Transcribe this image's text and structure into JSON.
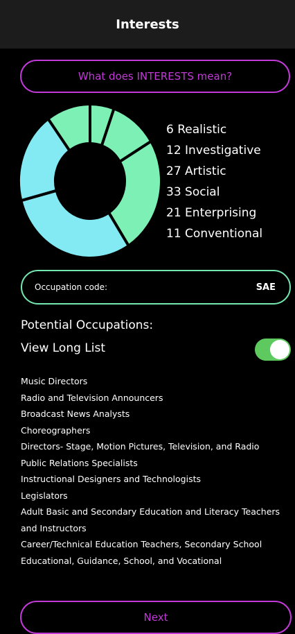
{
  "header": {
    "title": "Interests"
  },
  "meaning_button": {
    "label": "What does INTERESTS mean?"
  },
  "chart_data": {
    "type": "pie",
    "categories": [
      "Realistic",
      "Investigative",
      "Artistic",
      "Social",
      "Enterprising",
      "Conventional"
    ],
    "values": [
      6,
      12,
      27,
      33,
      21,
      11
    ],
    "colors": [
      "#7df0b6",
      "#7df0b6",
      "#7df0b6",
      "#83eaf4",
      "#83eaf4",
      "#7df0b6"
    ]
  },
  "interest_types": [
    {
      "value": "6",
      "name": "Realistic"
    },
    {
      "value": "12",
      "name": "Investigative"
    },
    {
      "value": "27",
      "name": "Artistic"
    },
    {
      "value": "33",
      "name": "Social"
    },
    {
      "value": "21",
      "name": "Enterprising"
    },
    {
      "value": "11",
      "name": "Conventional"
    }
  ],
  "occupation_code": {
    "label": "Occupation code:",
    "value": "SAE"
  },
  "potential_occupations": {
    "title": "Potential Occupations:",
    "long_list_label": "View Long List",
    "long_list_enabled": true
  },
  "occupations": [
    "Music Directors",
    "Radio and Television Announcers",
    "Broadcast News Analysts",
    "Choreographers",
    "Directors- Stage, Motion Pictures, Television, and Radio",
    "Public Relations Specialists",
    "Instructional Designers and Technologists",
    "Legislators",
    "Adult Basic and Secondary Education and Literacy Teachers and Instructors",
    "Career/Technical Education Teachers, Secondary School",
    "Educational, Guidance, School, and Vocational"
  ],
  "next_button": {
    "label": "Next"
  },
  "colors": {
    "accent_purple": "#c13ad7",
    "accent_green": "#74e8b0",
    "toggle_green": "#5ec95f",
    "chart_green": "#7df0b6",
    "chart_cyan": "#83eaf4",
    "header_bg": "#1c1c1c"
  }
}
